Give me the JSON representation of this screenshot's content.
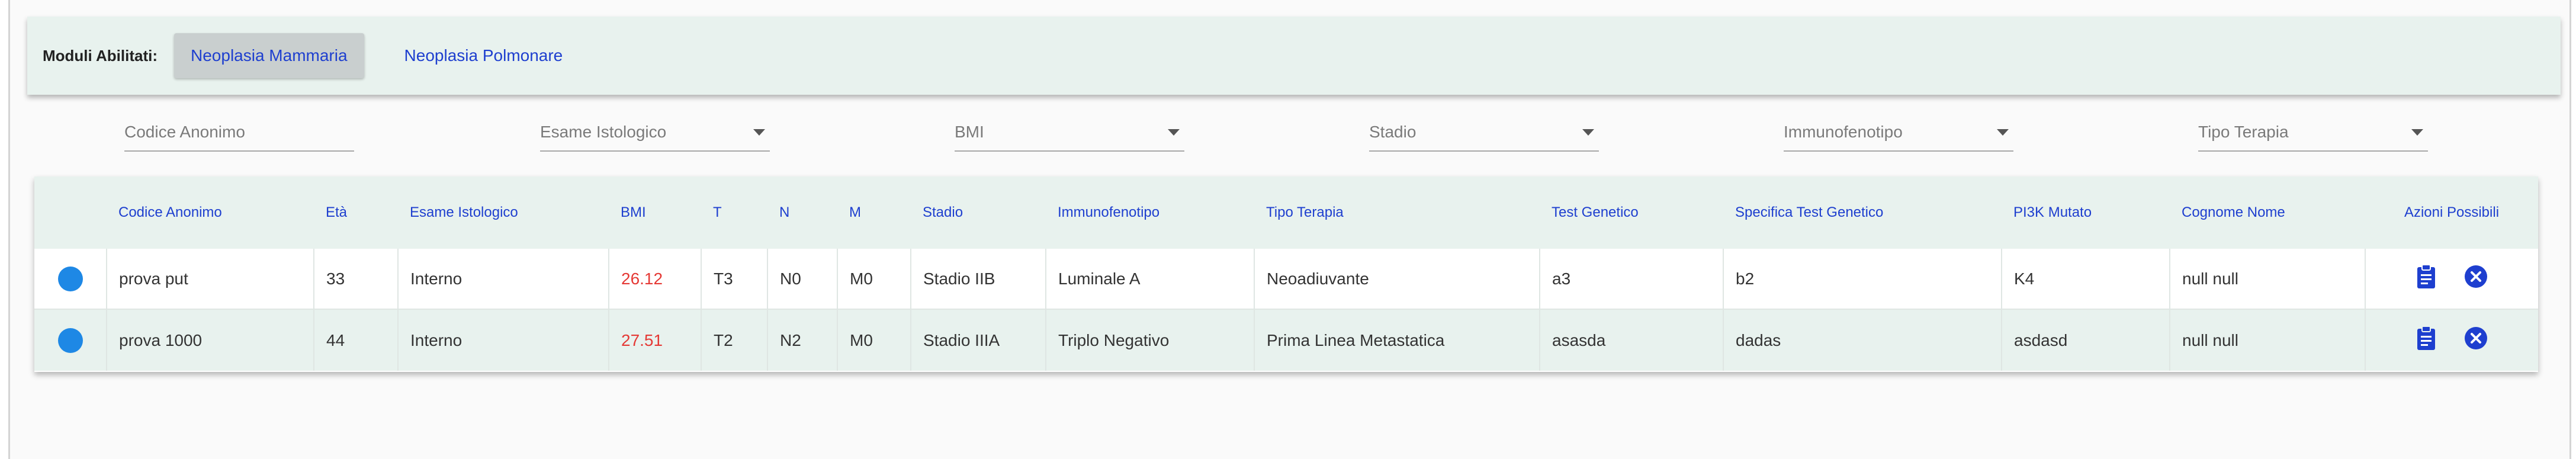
{
  "modules": {
    "label": "Moduli Abilitati:",
    "items": [
      {
        "label": "Neoplasia Mammaria",
        "active": true
      },
      {
        "label": "Neoplasia Polmonare",
        "active": false
      }
    ]
  },
  "filters": {
    "codice": {
      "placeholder": "Codice Anonimo"
    },
    "esame": {
      "label": "Esame Istologico"
    },
    "bmi": {
      "label": "BMI"
    },
    "stadio": {
      "label": "Stadio"
    },
    "immunofenotipo": {
      "label": "Immunofenotipo"
    },
    "terapia": {
      "label": "Tipo Terapia"
    }
  },
  "table": {
    "headers": [
      "Codice Anonimo",
      "Età",
      "Esame Istologico",
      "BMI",
      "T",
      "N",
      "M",
      "Stadio",
      "Immunofenotipo",
      "Tipo Terapia",
      "Test Genetico",
      "Specifica Test Genetico",
      "PI3K Mutato",
      "Cognome Nome",
      "Azioni Possibili"
    ],
    "rows": [
      {
        "codice": "prova put",
        "eta": "33",
        "esame": "Interno",
        "bmi": "26.12",
        "t": "T3",
        "n": "N0",
        "m": "M0",
        "stadio": "Stadio IIB",
        "immunofenotipo": "Luminale A",
        "terapia": "Neoadiuvante",
        "test": "a3",
        "specifica": "b2",
        "pi3k": "K4",
        "nome": "null null"
      },
      {
        "codice": "prova 1000",
        "eta": "44",
        "esame": "Interno",
        "bmi": "27.51",
        "t": "T2",
        "n": "N2",
        "m": "M0",
        "stadio": "Stadio IIIA",
        "immunofenotipo": "Triplo Negativo",
        "terapia": "Prima Linea Metastatica",
        "test": "asasda",
        "specifica": "dadas",
        "pi3k": "asdasd",
        "nome": "null null"
      }
    ],
    "status_icon": "status-dot",
    "action_icons": [
      "clipboard-icon",
      "close-circle-icon"
    ]
  },
  "colors": {
    "accent": "#1e3fcf",
    "header_bg": "#e8f2ee",
    "status_dot": "#1e88e5",
    "bmi_text": "#e53935"
  }
}
